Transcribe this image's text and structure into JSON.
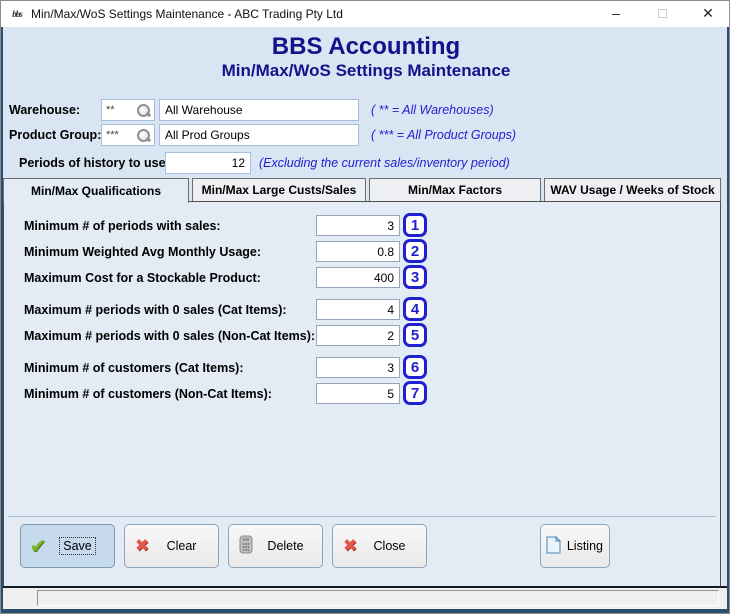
{
  "titlebar": {
    "icon_text": "bbs",
    "title": "Min/Max/WoS Settings Maintenance - ABC Trading Pty Ltd",
    "minimize_glyph": "–",
    "close_glyph": "✕"
  },
  "header": {
    "app_name": "BBS Accounting",
    "screen_name": "Min/Max/WoS Settings Maintenance"
  },
  "filters": {
    "warehouse": {
      "label": "Warehouse:",
      "code": "**",
      "value": "All Warehouse",
      "note": "( ** = All Warehouses)"
    },
    "product_group": {
      "label": "Product Group:",
      "code": "***",
      "value": "All Prod Groups",
      "note": "( *** = All Product Groups)"
    },
    "periods": {
      "label": "Periods of history to use:",
      "value": "12",
      "note": "(Excluding the current sales/inventory period)"
    }
  },
  "tabs": [
    {
      "label": "Min/Max Qualifications",
      "active": true
    },
    {
      "label": "Min/Max Large Custs/Sales",
      "active": false
    },
    {
      "label": "Min/Max Factors",
      "active": false
    },
    {
      "label": "WAV Usage / Weeks of Stock",
      "active": false
    }
  ],
  "fields": [
    {
      "label": "Minimum # of periods with sales:",
      "value": "3",
      "badge": "1"
    },
    {
      "label": "Minimum Weighted Avg Monthly Usage:",
      "value": "0.8",
      "badge": "2"
    },
    {
      "label": "Maximum Cost for a Stockable Product:",
      "value": "400",
      "badge": "3"
    },
    {
      "label": "Maximum # periods with 0 sales (Cat Items):",
      "value": "4",
      "badge": "4"
    },
    {
      "label": "Maximum # periods with 0 sales (Non-Cat Items):",
      "value": "2",
      "badge": "5"
    },
    {
      "label": "Minimum # of customers (Cat Items):",
      "value": "3",
      "badge": "6"
    },
    {
      "label": "Minimum # of customers (Non-Cat Items):",
      "value": "5",
      "badge": "7"
    }
  ],
  "buttons": {
    "save": {
      "label": "Save",
      "icon_glyph": "✔"
    },
    "clear": {
      "label": "Clear",
      "icon_glyph": "✖"
    },
    "delete": {
      "label": "Delete"
    },
    "close": {
      "label": "Close",
      "icon_glyph": "✖"
    },
    "listing": {
      "label": "Listing"
    }
  },
  "colors": {
    "header_navy": "#12128a",
    "note_blue": "#1f1fd0",
    "badge_blue": "#2020cf",
    "body_bg": "#d9e5f2",
    "panel_bg": "#e3ebf5",
    "save_green": "#76b82a",
    "cancel_red": "#e2574c",
    "window_edge": "#2b4d6e"
  }
}
